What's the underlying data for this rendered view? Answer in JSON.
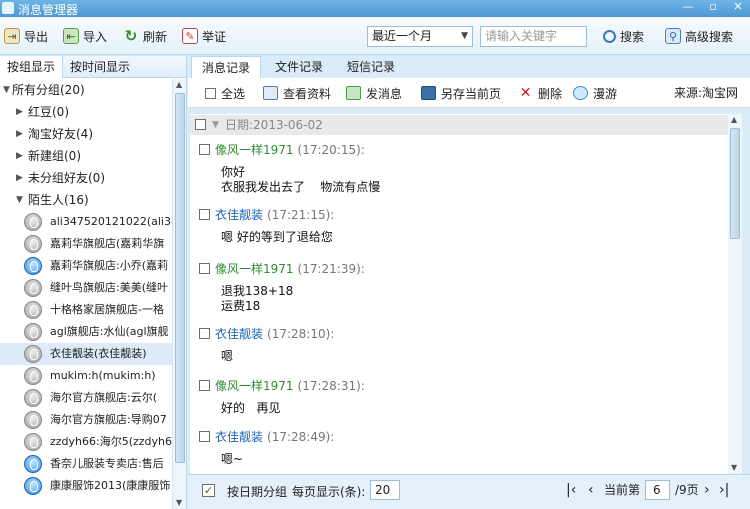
{
  "window": {
    "title": "消息管理器",
    "min": "—",
    "max": "▫",
    "close": "✕"
  },
  "toolbar": {
    "export_label": "导出",
    "import_label": "导入",
    "refresh_label": "刷新",
    "report_label": "举证",
    "range_value": "最近一个月",
    "range_arrow": "▼",
    "keyword_placeholder": "请输入关键字",
    "search_label": "搜索",
    "advanced_label": "高级搜索"
  },
  "left": {
    "tab_group": "按组显示",
    "tab_time": "按时间显示",
    "root": {
      "arrow": "▼",
      "label": "所有分组(20)"
    },
    "groups": [
      {
        "arrow": "▶",
        "label": "红豆(0)"
      },
      {
        "arrow": "▶",
        "label": "淘宝好友(4)"
      },
      {
        "arrow": "▶",
        "label": "新建组(0)"
      },
      {
        "arrow": "▶",
        "label": "未分组好友(0)"
      },
      {
        "arrow": "▼",
        "label": "陌生人(16)"
      }
    ],
    "contacts": [
      {
        "label": "ali347520121022(ali34",
        "status": "offline"
      },
      {
        "label": "嘉莉华旗舰店(嘉莉华旗",
        "status": "offline"
      },
      {
        "label": "嘉莉华旗舰店:小乔(嘉莉",
        "status": "online"
      },
      {
        "label": "缝叶鸟旗舰店:美美(缝叶",
        "status": "offline"
      },
      {
        "label": "十格格家居旗舰店-一格",
        "status": "offline"
      },
      {
        "label": "agl旗舰店:水仙(agl旗舰",
        "status": "offline"
      },
      {
        "label": "衣佳靓装(衣佳靓装)",
        "status": "offline"
      },
      {
        "label": "mukim:h(mukim:h)",
        "status": "offline"
      },
      {
        "label": "海尔官方旗舰店:云尔(",
        "status": "offline"
      },
      {
        "label": "海尔官方旗舰店:导购07",
        "status": "offline"
      },
      {
        "label": "zzdyh66:海尔5(zzdyh66",
        "status": "offline"
      },
      {
        "label": "香奈儿服装专卖店:售后",
        "status": "online"
      },
      {
        "label": "康康服饰2013(康康服饰",
        "status": "online"
      }
    ],
    "scroll_up": "▲",
    "scroll_down": "▼"
  },
  "right": {
    "tabs": [
      "消息记录",
      "文件记录",
      "短信记录"
    ],
    "select_all": "全选",
    "view_profile": "查看资料",
    "send_message": "发消息",
    "save_page": "另存当前页",
    "delete": "删除",
    "roam": "漫游",
    "source": "来源:淘宝网",
    "date_label": "日期:2013-06-02",
    "date_tri": "▼",
    "messages": [
      {
        "sender": "像风一样1971",
        "time": "(17:20:15):",
        "body": "你好\n衣服我发出去了    物流有点慢",
        "color": "green"
      },
      {
        "sender": "衣佳靓装",
        "time": "(17:21:15):",
        "body": "嗯 好的等到了退给您",
        "color": "blue"
      },
      {
        "sender": "像风一样1971",
        "time": "(17:21:39):",
        "body": "退我138+18\n运费18",
        "color": "green"
      },
      {
        "sender": "衣佳靓装",
        "time": "(17:28:10):",
        "body": "嗯",
        "color": "blue"
      },
      {
        "sender": "像风一样1971",
        "time": "(17:28:31):",
        "body": "好的   再见",
        "color": "green"
      },
      {
        "sender": "衣佳靓装",
        "time": "(17:28:49):",
        "body": "嗯~",
        "color": "blue"
      }
    ],
    "scroll_up": "▲",
    "scroll_down": "▼"
  },
  "footer": {
    "group_by_date": "按日期分组",
    "checkmark": "✓",
    "per_page_label": "每页显示(条):",
    "per_page_value": "20",
    "first": "|‹",
    "prev": "‹",
    "current_label": "当前第",
    "current_page": "6",
    "total": "/9页",
    "next": "›",
    "last": "›|"
  }
}
